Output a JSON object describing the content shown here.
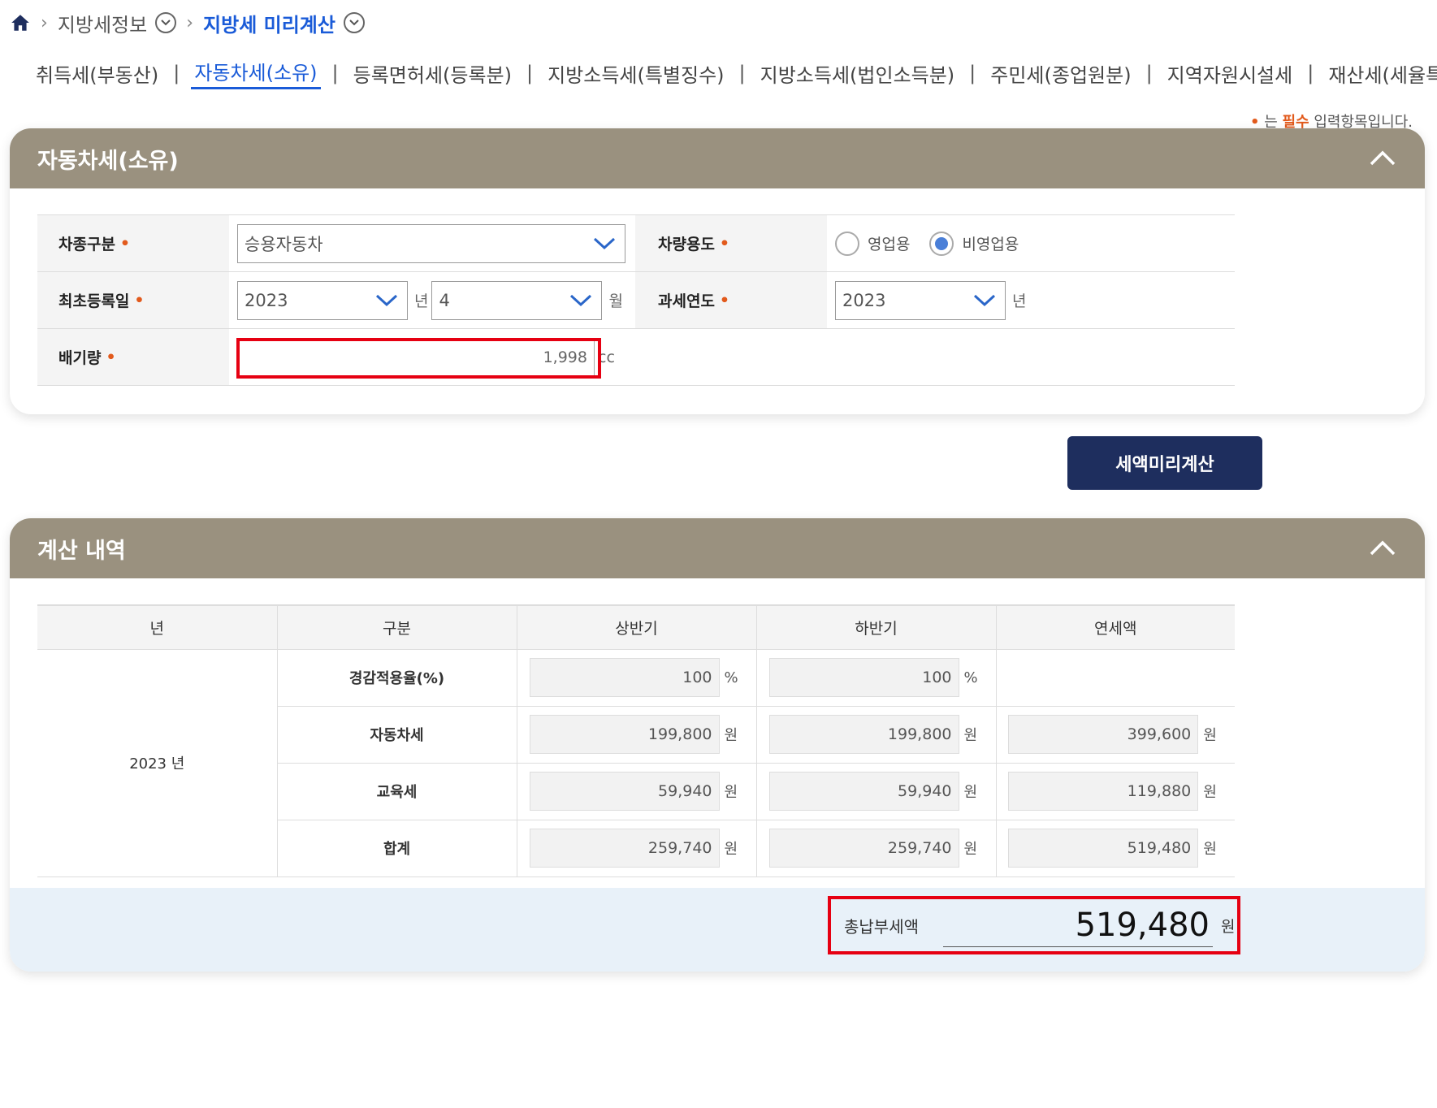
{
  "breadcrumb": {
    "items": [
      {
        "label": "지방세정보"
      },
      {
        "label": "지방세 미리계산"
      }
    ]
  },
  "tabs": [
    {
      "label": "취득세(부동산)"
    },
    {
      "label": "자동차세(소유)",
      "active": true
    },
    {
      "label": "등록면허세(등록분)"
    },
    {
      "label": "지방소득세(특별징수)"
    },
    {
      "label": "지방소득세(법인소득분)"
    },
    {
      "label": "주민세(종업원분)"
    },
    {
      "label": "지역자원시설세"
    },
    {
      "label": "재산세(세율특례)"
    }
  ],
  "required_note": {
    "dot": "•",
    "prefix": "는 ",
    "must": "필수",
    "suffix": " 입력항목입니다."
  },
  "form_panel": {
    "title": "자동차세(소유)",
    "vehicle_type": {
      "label": "차종구분",
      "value": "승용자동차"
    },
    "vehicle_use": {
      "label": "차량용도",
      "options": [
        "영업용",
        "비영업용"
      ],
      "selected": "비영업용"
    },
    "first_reg": {
      "label": "최초등록일",
      "year": "2023",
      "year_unit": "년",
      "month": "4",
      "month_unit": "월"
    },
    "tax_year": {
      "label": "과세연도",
      "value": "2023",
      "unit": "년"
    },
    "displacement": {
      "label": "배기량",
      "value": "1,998",
      "unit": "cc"
    }
  },
  "calc_button": "세액미리계산",
  "result_panel": {
    "title": "계산 내역",
    "headers": [
      "년",
      "구분",
      "상반기",
      "하반기",
      "연세액"
    ],
    "year_label": "2023 년",
    "rows": [
      {
        "name": "경감적용율(%)",
        "h1": "100",
        "h2": "100",
        "annual": "",
        "unit": "%"
      },
      {
        "name": "자동차세",
        "h1": "199,800",
        "h2": "199,800",
        "annual": "399,600",
        "unit": "원"
      },
      {
        "name": "교육세",
        "h1": "59,940",
        "h2": "59,940",
        "annual": "119,880",
        "unit": "원"
      },
      {
        "name": "합계",
        "h1": "259,740",
        "h2": "259,740",
        "annual": "519,480",
        "unit": "원"
      }
    ],
    "total": {
      "label": "총납부세액",
      "value": "519,480",
      "unit": "원"
    }
  },
  "colors": {
    "header_bg": "#9a917f",
    "accent": "#1a5bd8",
    "button_bg": "#1e2e5e",
    "highlight": "#e60012",
    "required": "#e25a1c"
  }
}
